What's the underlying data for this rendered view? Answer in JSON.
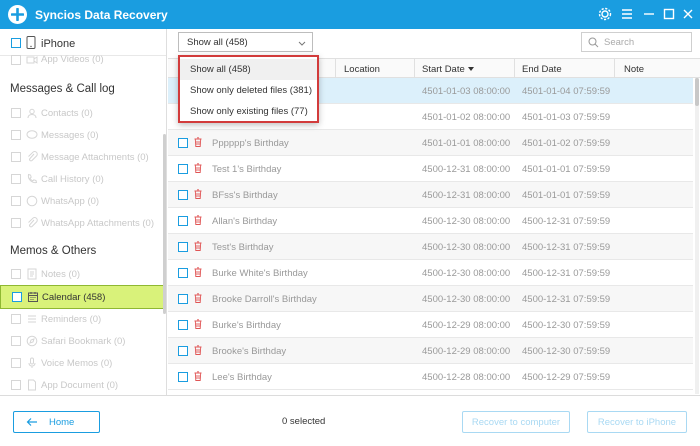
{
  "window": {
    "title": "Syncios Data Recovery",
    "icons": [
      "settings-icon",
      "menu-icon",
      "minimize-icon",
      "maximize-icon",
      "close-icon"
    ]
  },
  "sidebar": {
    "device": "iPhone",
    "partial_item": "App Videos (0)",
    "section_messages": "Messages & Call log",
    "messages_items": [
      "Contacts (0)",
      "Messages (0)",
      "Message Attachments (0)",
      "Call History (0)",
      "WhatsApp (0)",
      "WhatsApp Attachments (0)"
    ],
    "section_memos": "Memos & Others",
    "memos_items": [
      "Notes (0)",
      "Calendar (458)",
      "Reminders (0)",
      "Safari Bookmark (0)",
      "Voice Memos (0)",
      "App Document (0)"
    ],
    "active_item": "Calendar (458)"
  },
  "toolbar": {
    "filter_value": "Show all (458)",
    "search_placeholder": "Search"
  },
  "dropdown": {
    "options": [
      "Show all (458)",
      "Show only deleted files (381)",
      "Show only existing files (77)"
    ]
  },
  "table": {
    "columns": [
      "Location",
      "Start Date",
      "End Date",
      "Note"
    ],
    "sorted_column": "Start Date",
    "rows": [
      {
        "name": "",
        "start": "4501-01-03 08:00:00",
        "end": "4501-01-04 07:59:59"
      },
      {
        "name": "",
        "start": "4501-01-02 08:00:00",
        "end": "4501-01-03 07:59:59"
      },
      {
        "name": "Pppppp's Birthday",
        "start": "4501-01-01 08:00:00",
        "end": "4501-01-02 07:59:59"
      },
      {
        "name": "Test 1's Birthday",
        "start": "4500-12-31 08:00:00",
        "end": "4501-01-01 07:59:59"
      },
      {
        "name": "BFss's Birthday",
        "start": "4500-12-31 08:00:00",
        "end": "4501-01-01 07:59:59"
      },
      {
        "name": "Allan's Birthday",
        "start": "4500-12-30 08:00:00",
        "end": "4500-12-31 07:59:59"
      },
      {
        "name": "Test's Birthday",
        "start": "4500-12-30 08:00:00",
        "end": "4500-12-31 07:59:59"
      },
      {
        "name": "Burke White's Birthday",
        "start": "4500-12-30 08:00:00",
        "end": "4500-12-31 07:59:59"
      },
      {
        "name": "Brooke Darroll's Birthday",
        "start": "4500-12-30 08:00:00",
        "end": "4500-12-31 07:59:59"
      },
      {
        "name": "Burke's Birthday",
        "start": "4500-12-29 08:00:00",
        "end": "4500-12-30 07:59:59"
      },
      {
        "name": "Brooke's Birthday",
        "start": "4500-12-29 08:00:00",
        "end": "4500-12-30 07:59:59"
      },
      {
        "name": "Lee's Birthday",
        "start": "4500-12-28 08:00:00",
        "end": "4500-12-29 07:59:59"
      }
    ]
  },
  "footer": {
    "home_label": "Home",
    "selected_count": "0 selected",
    "recover_computer_label": "Recover to computer",
    "recover_iphone_label": "Recover to iPhone"
  },
  "colors": {
    "accent": "#1a9de0",
    "active_item_bg": "#d9f27a",
    "highlight_border": "#d23b3b",
    "trash_icon": "#e05555"
  }
}
